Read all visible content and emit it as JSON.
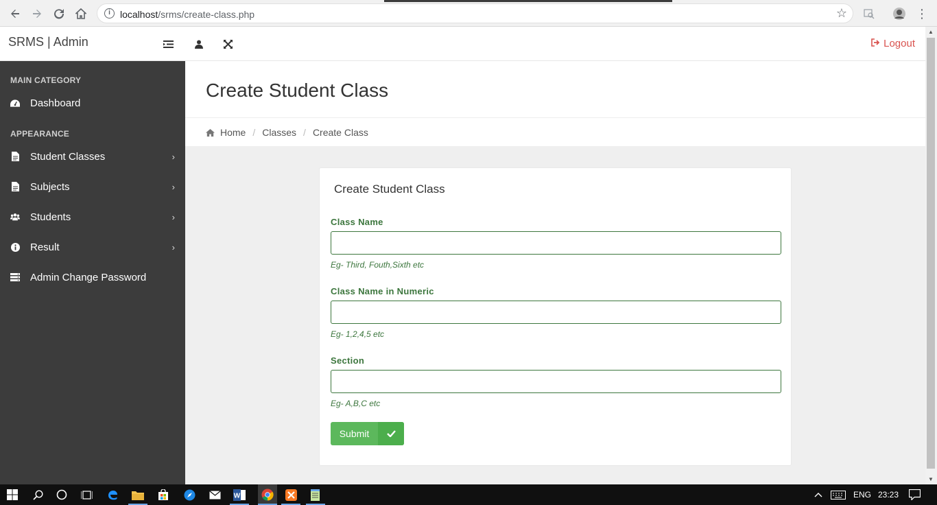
{
  "browser": {
    "url_host": "localhost",
    "url_path": "/srms/create-class.php"
  },
  "header": {
    "brand": "SRMS | Admin",
    "logout_label": "Logout"
  },
  "sidebar": {
    "categories": [
      "MAIN CATEGORY",
      "APPEARANCE"
    ],
    "items": [
      {
        "label": "Dashboard",
        "icon": "dashboard-icon"
      },
      {
        "label": "Student Classes",
        "icon": "file-icon",
        "has_submenu": true
      },
      {
        "label": "Subjects",
        "icon": "file-icon",
        "has_submenu": true
      },
      {
        "label": "Students",
        "icon": "users-icon",
        "has_submenu": true
      },
      {
        "label": "Result",
        "icon": "info-icon",
        "has_submenu": true
      },
      {
        "label": "Admin Change Password",
        "icon": "server-icon"
      }
    ]
  },
  "page": {
    "title": "Create Student Class",
    "breadcrumb": [
      "Home",
      "Classes",
      "Create Class"
    ]
  },
  "form": {
    "panel_title": "Create Student Class",
    "fields": [
      {
        "label": "Class Name",
        "value": "",
        "help": "Eg- Third, Fouth,Sixth etc"
      },
      {
        "label": "Class Name in Numeric",
        "value": "",
        "help": "Eg- 1,2,4,5 etc"
      },
      {
        "label": "Section",
        "value": "",
        "help": "Eg- A,B,C etc"
      }
    ],
    "submit_label": "Submit"
  },
  "taskbar": {
    "lang": "ENG",
    "time": "23:23"
  },
  "colors": {
    "sidebar_bg": "#3c3c3c",
    "success_green": "#5cb85c",
    "label_green": "#3c763d",
    "logout_red": "#d9534f"
  }
}
